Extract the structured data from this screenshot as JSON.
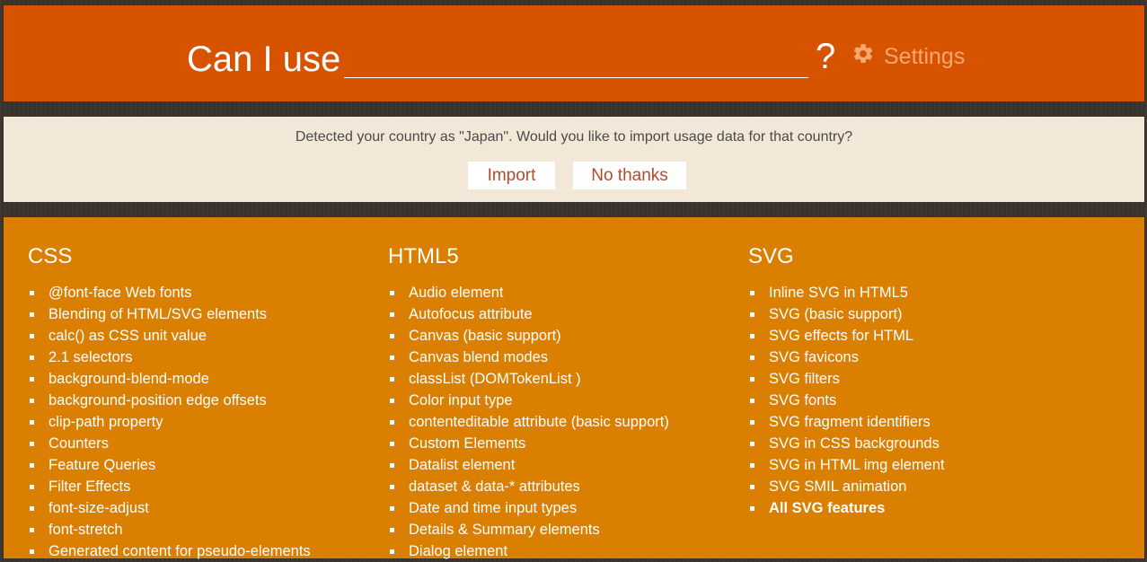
{
  "header": {
    "title": "Can I use",
    "search_value": "",
    "question_mark": "?",
    "settings_label": "Settings"
  },
  "notice": {
    "text": "Detected your country as \"Japan\". Would you like to import usage data for that country?",
    "import_label": "Import",
    "no_thanks_label": "No thanks"
  },
  "columns": [
    {
      "heading": "CSS",
      "items": [
        "@font-face Web fonts",
        "Blending of HTML/SVG elements",
        "calc() as CSS unit value",
        "2.1 selectors",
        "background-blend-mode",
        "background-position edge offsets",
        "clip-path property",
        "Counters",
        "Feature Queries",
        "Filter Effects",
        "font-size-adjust",
        "font-stretch",
        "Generated content for pseudo-elements"
      ]
    },
    {
      "heading": "HTML5",
      "items": [
        "Audio element",
        "Autofocus attribute",
        "Canvas (basic support)",
        "Canvas blend modes",
        "classList (DOMTokenList )",
        "Color input type",
        "contenteditable attribute (basic support)",
        "Custom Elements",
        "Datalist element",
        "dataset & data-* attributes",
        "Date and time input types",
        "Details & Summary elements",
        "Dialog element"
      ]
    },
    {
      "heading": "SVG",
      "items": [
        "Inline SVG in HTML5",
        "SVG (basic support)",
        "SVG effects for HTML",
        "SVG favicons",
        "SVG filters",
        "SVG fonts",
        "SVG fragment identifiers",
        "SVG in CSS backgrounds",
        "SVG in HTML img element",
        "SVG SMIL animation"
      ],
      "all_label": "All SVG features"
    }
  ]
}
